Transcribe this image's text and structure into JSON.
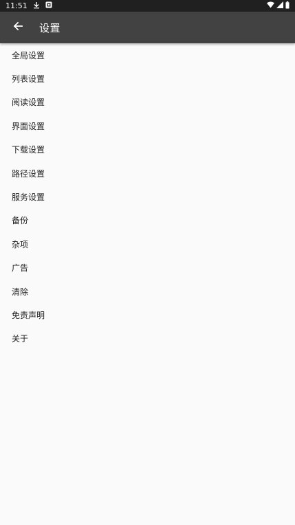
{
  "status_bar": {
    "time": "11:51",
    "icons": [
      "download-icon",
      "notification-icon",
      "wifi-icon",
      "signal-icon",
      "battery-icon"
    ]
  },
  "app_bar": {
    "back_icon": "arrow-back-icon",
    "title": "设置"
  },
  "settings": {
    "items": [
      {
        "label": "全局设置"
      },
      {
        "label": "列表设置"
      },
      {
        "label": "阅读设置"
      },
      {
        "label": "界面设置"
      },
      {
        "label": "下载设置"
      },
      {
        "label": "路径设置"
      },
      {
        "label": "服务设置"
      },
      {
        "label": "备份"
      },
      {
        "label": "杂项"
      },
      {
        "label": "广告"
      },
      {
        "label": "清除"
      },
      {
        "label": "免责声明"
      },
      {
        "label": "关于"
      }
    ]
  },
  "colors": {
    "status_bar_bg": "#202020",
    "app_bar_bg": "#424242",
    "page_bg": "#fafafa",
    "item_text": "#222222"
  }
}
